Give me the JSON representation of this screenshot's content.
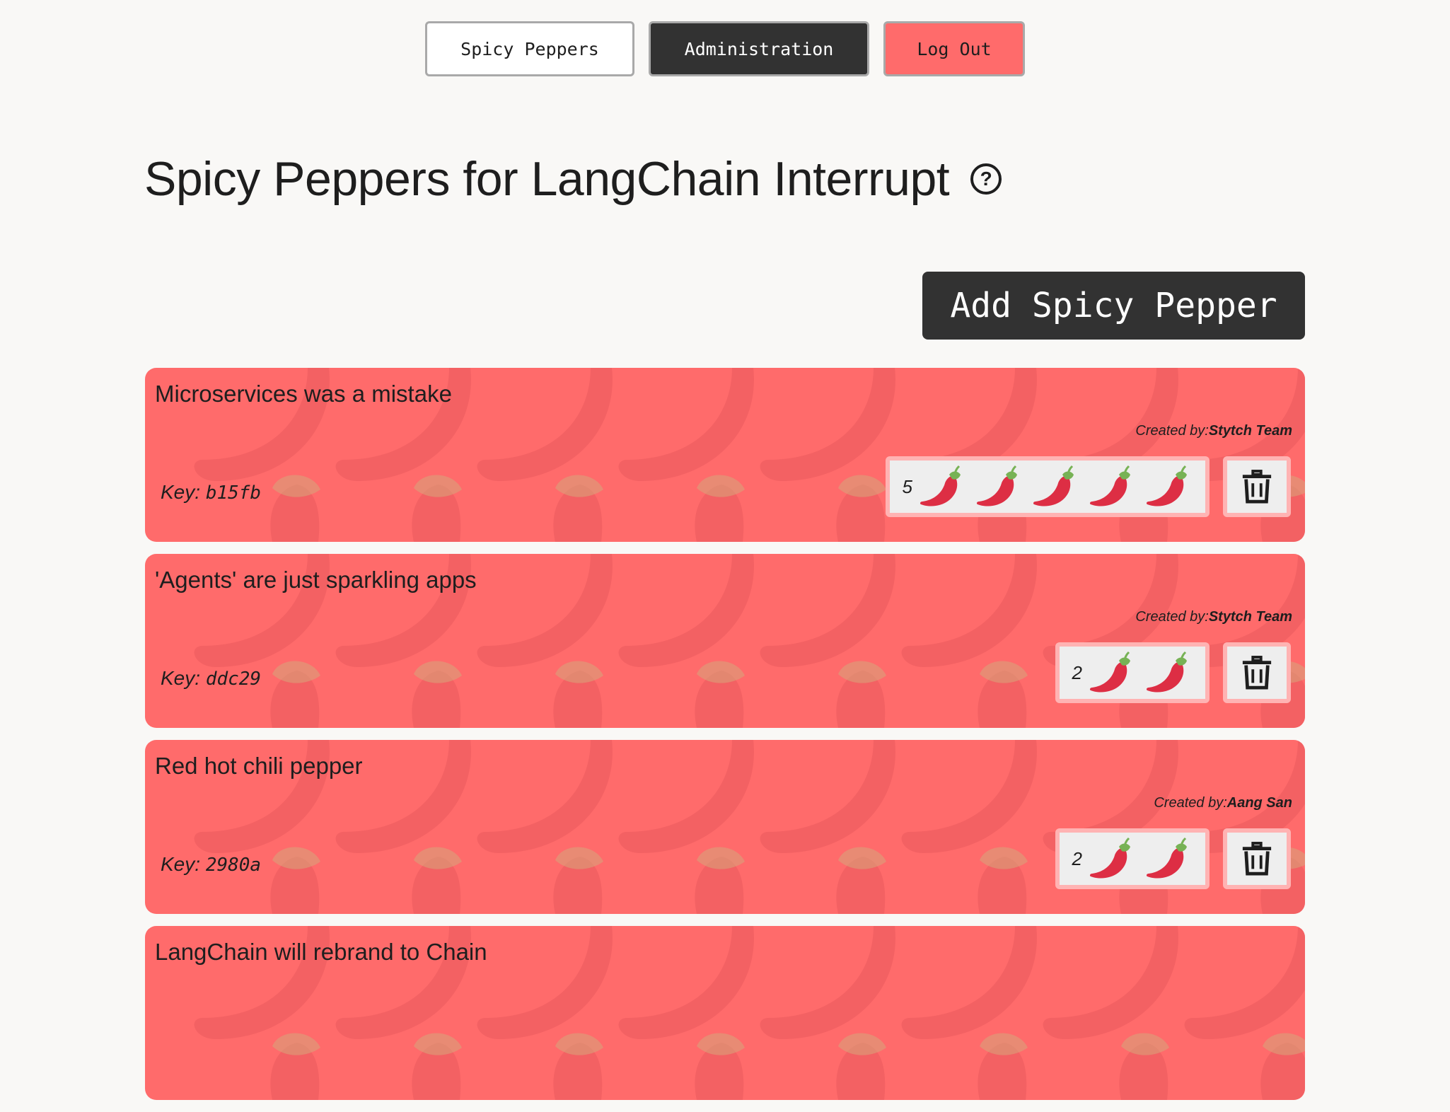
{
  "nav": {
    "spicy_peppers": "Spicy Peppers",
    "administration": "Administration",
    "log_out": "Log Out"
  },
  "page": {
    "title": "Spicy Peppers for LangChain Interrupt",
    "help_icon": "question-circle-icon",
    "add_button": "Add Spicy Pepper"
  },
  "labels": {
    "created_by": "Created by:",
    "key": "Key:"
  },
  "colors": {
    "card": "#ff6b6b",
    "dark_button": "#323232",
    "logout": "#ff6b6b"
  },
  "peppers": [
    {
      "title": "Microservices was a mistake",
      "creator": "Stytch Team",
      "key": "b15fb",
      "rating": 5
    },
    {
      "title": "'Agents' are just sparkling apps",
      "creator": "Stytch Team",
      "key": "ddc29",
      "rating": 2
    },
    {
      "title": "Red hot chili pepper",
      "creator": "Aang San",
      "key": "2980a",
      "rating": 2
    },
    {
      "title": "LangChain will rebrand to Chain",
      "creator": "",
      "key": "",
      "rating": 0
    }
  ]
}
